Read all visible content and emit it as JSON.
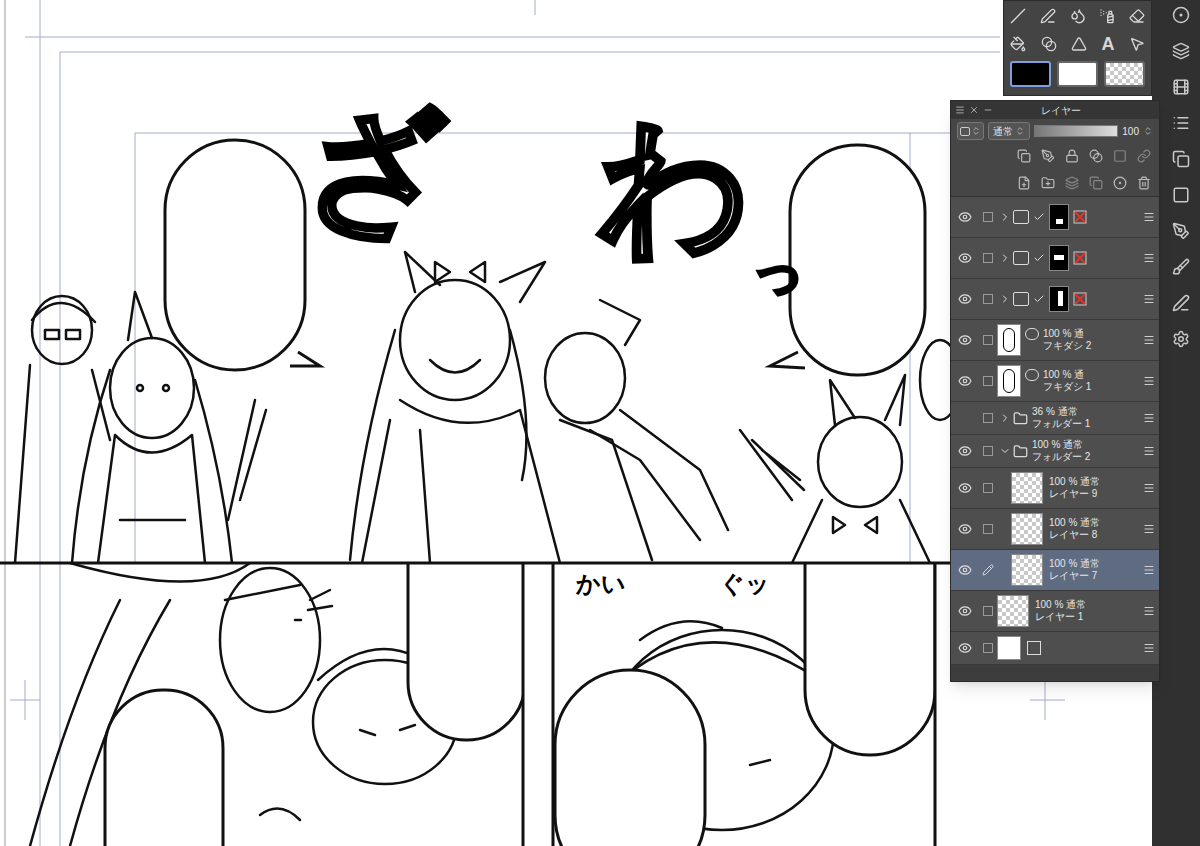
{
  "canvas": {
    "sound_effects": [
      {
        "text": "ざ"
      },
      {
        "text": "わ"
      },
      {
        "text": "っ"
      },
      {
        "text": "かい"
      },
      {
        "text": "ぐッ"
      }
    ]
  },
  "tool_palette": {
    "text_tool": "A",
    "colors": [
      {
        "kind": "solid",
        "color": "#000000",
        "selected": true
      },
      {
        "kind": "solid",
        "color": "#ffffff",
        "selected": false
      },
      {
        "kind": "checker",
        "selected": false
      }
    ]
  },
  "layer_panel": {
    "title": "レイヤー",
    "blend_mode": "通常",
    "opacity": "100",
    "opacity_level": 1,
    "layers": [
      {
        "kind": "mask-folder",
        "visible": true,
        "selected": false,
        "expanded": false,
        "checked": true
      },
      {
        "kind": "mask-folder",
        "visible": true,
        "selected": false,
        "expanded": false,
        "checked": true
      },
      {
        "kind": "mask-folder",
        "visible": true,
        "selected": false,
        "expanded": false,
        "checked": true
      },
      {
        "kind": "balloon",
        "name": "フキダシ 2",
        "mode": "100 % 通",
        "visible": true,
        "selected": false
      },
      {
        "kind": "balloon",
        "name": "フキダシ 1",
        "mode": "100 % 通",
        "visible": true,
        "selected": false
      },
      {
        "kind": "folder",
        "name": "フォルダー 1",
        "mode": "36 % 通常",
        "visible": false,
        "selected": false,
        "expanded": false
      },
      {
        "kind": "folder",
        "name": "フォルダー 2",
        "mode": "100 % 通常",
        "visible": true,
        "selected": false,
        "expanded": true
      },
      {
        "kind": "raster",
        "name": "レイヤー 9",
        "mode": "100 % 通常",
        "visible": true,
        "selected": false,
        "editing": false,
        "depth": 1
      },
      {
        "kind": "raster",
        "name": "レイヤー 8",
        "mode": "100 % 通常",
        "visible": true,
        "selected": false,
        "editing": false,
        "depth": 1
      },
      {
        "kind": "raster",
        "name": "レイヤー 7",
        "mode": "100 % 通常",
        "visible": true,
        "selected": true,
        "editing": true,
        "depth": 1
      },
      {
        "kind": "raster",
        "name": "レイヤー 1",
        "mode": "100 % 通常",
        "visible": true,
        "selected": false,
        "editing": false,
        "depth": 0
      },
      {
        "kind": "paper",
        "visible": true,
        "selected": false
      }
    ]
  }
}
